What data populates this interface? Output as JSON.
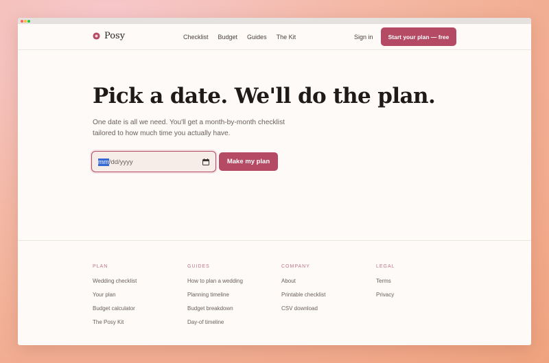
{
  "brand": {
    "name": "Posy",
    "accent": "#b54a64"
  },
  "nav": {
    "links": [
      "Checklist",
      "Budget",
      "Guides",
      "The Kit"
    ],
    "signin": "Sign in",
    "cta": "Start your plan — free"
  },
  "hero": {
    "title": "Pick a date. We'll do the plan.",
    "subtitle": "One date is all we need. You'll get a month-by-month checklist tailored to how much time you actually have.",
    "date_highlight": "mm",
    "date_rest": "/dd/yyyy",
    "button": "Make my plan"
  },
  "footer": {
    "columns": [
      {
        "heading": "PLAN",
        "links": [
          "Wedding checklist",
          "Your plan",
          "Budget calculator",
          "The Posy Kit"
        ]
      },
      {
        "heading": "GUIDES",
        "links": [
          "How to plan a wedding",
          "Planning timeline",
          "Budget breakdown",
          "Day-of timeline"
        ]
      },
      {
        "heading": "COMPANY",
        "links": [
          "About",
          "Printable checklist",
          "CSV download"
        ]
      },
      {
        "heading": "LEGAL",
        "links": [
          "Terms",
          "Privacy"
        ]
      }
    ]
  }
}
